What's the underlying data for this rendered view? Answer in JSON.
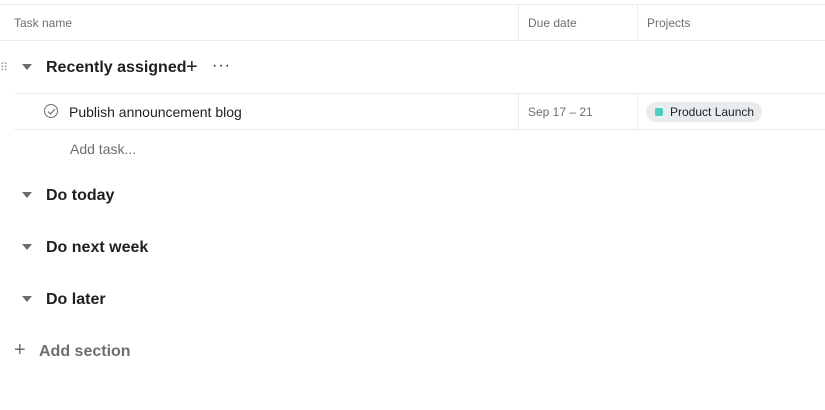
{
  "columns": {
    "task_name": "Task name",
    "due_date": "Due date",
    "projects": "Projects"
  },
  "sections": [
    {
      "title": "Recently assigned",
      "add_glyph": "+",
      "more_glyph": "···"
    },
    {
      "title": "Do today"
    },
    {
      "title": "Do next week"
    },
    {
      "title": "Do later"
    }
  ],
  "tasks": [
    {
      "name": "Publish announcement blog",
      "due": "Sep 17 – 21",
      "project": {
        "label": "Product Launch",
        "color": "#4ecbc4"
      }
    }
  ],
  "add_task_label": "Add task...",
  "add_section": {
    "glyph": "+",
    "label": "Add section"
  },
  "icons": {
    "drag": "drag-handle-icon",
    "caret": "caret-down-icon",
    "check": "check-circle-icon",
    "plus": "plus-icon",
    "more": "more-icon"
  }
}
